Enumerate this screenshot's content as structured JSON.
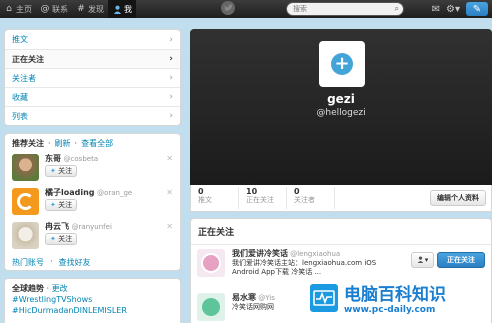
{
  "topbar": {
    "nav": [
      {
        "icon": "home-icon",
        "glyph": "⌂",
        "label": "主页"
      },
      {
        "icon": "at-icon",
        "glyph": "@",
        "label": "联系"
      },
      {
        "icon": "hashtag-icon",
        "glyph": "#",
        "label": "发现"
      },
      {
        "icon": "person-icon",
        "glyph": "👤",
        "label": "我"
      }
    ],
    "search_placeholder": "搜索"
  },
  "sidebar": {
    "menu": [
      "推文",
      "正在关注",
      "关注者",
      "收藏",
      "列表"
    ],
    "suggest_header": {
      "title": "推荐关注",
      "refresh": "刷新",
      "view_all": "查看全部"
    },
    "suggestions": [
      {
        "name": "东哥",
        "handle": "@cosbeta",
        "follow": "关注"
      },
      {
        "name": "橘子loading",
        "handle": "@oran_ge",
        "follow": "关注"
      },
      {
        "name": "冉云飞",
        "handle": "@ranyunfei",
        "follow": "关注"
      }
    ],
    "suggest_footer": {
      "popular": "热门账号",
      "find_friends": "查找好友"
    },
    "trends": {
      "title": "全球趋势",
      "change": "更改",
      "items": [
        "#WrestlingTVShows",
        "#HicDurmadanDINLEMISLER"
      ]
    }
  },
  "profile": {
    "name": "gezi",
    "handle": "@hellogezi",
    "stats": [
      {
        "num": "0",
        "label": "推文"
      },
      {
        "num": "10",
        "label": "正在关注"
      },
      {
        "num": "0",
        "label": "关注者"
      }
    ],
    "edit_button": "编辑个人资料"
  },
  "following": {
    "title": "正在关注",
    "items": [
      {
        "name": "我们爱讲冷笑话",
        "handle": "@lengxiaohua",
        "bio1": "我们爱讲冷笑话主站：lengxiaohua.com iOS",
        "bio2": "Android App下载",
        "bio3": "冷笑话 ..."
      },
      {
        "name": "易水寒",
        "handle": "@Yis",
        "bio1": "冷笑话网购网"
      }
    ],
    "following_button": "正在关注"
  },
  "watermark": {
    "title": "电脑百科知识",
    "url": "www.pc-daily.com"
  }
}
